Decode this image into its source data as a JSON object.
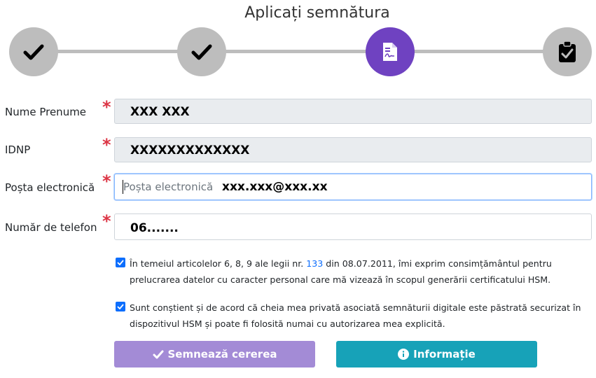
{
  "page": {
    "title": "Aplicați semnătura"
  },
  "stepper": {
    "steps": [
      {
        "icon": "check-icon",
        "state": "done"
      },
      {
        "icon": "check-icon",
        "state": "done"
      },
      {
        "icon": "document-signature-icon",
        "state": "active"
      },
      {
        "icon": "clipboard-check-icon",
        "state": "pending"
      }
    ],
    "active_color": "#6f42c1",
    "inactive_color": "#bdbdbd"
  },
  "form": {
    "name": {
      "label": "Nume Prenume",
      "value": "XXX XXX",
      "required_mark": "*"
    },
    "idnp": {
      "label": "IDNP",
      "value": "XXXXXXXXXXXXX",
      "required_mark": "*"
    },
    "email": {
      "label": "Poșta electronică",
      "placeholder": "Poșta electronică",
      "value": "xxx.xxx@xxx.xx",
      "required_mark": "*"
    },
    "phone": {
      "label": "Număr de telefon",
      "value": "06.......",
      "required_mark": "*"
    }
  },
  "consents": {
    "gdpr": {
      "checked": true,
      "text_before": "În temeiul articolelor 6, 8, 9 ale legii nr. ",
      "link_text": "133",
      "text_after": " din 08.07.2011, îmi exprim consimțământul pentru prelucrarea datelor cu caracter personal care mă vizează în scopul generării certificatului HSM."
    },
    "hsm": {
      "checked": true,
      "text": "Sunt conștient și de acord că cheia mea privată asociată semnăturii digitale este păstrată securizat în dispozitivul HSM și poate fi folosită numai cu autorizarea mea explicită."
    }
  },
  "buttons": {
    "sign": {
      "label": "Semnează cererea",
      "icon": "check-icon",
      "color": "#a38bd6"
    },
    "info": {
      "label": "Informație",
      "icon": "info-circle-icon",
      "color": "#17a2b8"
    }
  }
}
